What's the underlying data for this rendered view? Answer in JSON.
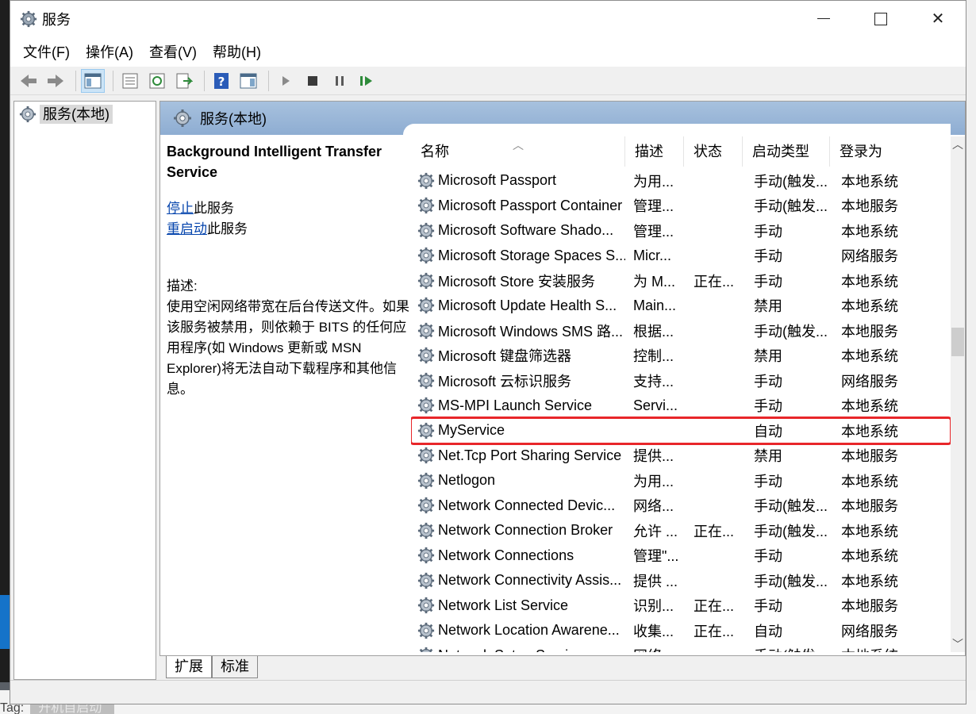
{
  "window": {
    "title": "服务",
    "controls": {
      "minimize": "minimize",
      "maximize": "maximize",
      "close": "✕"
    }
  },
  "menu": [
    "文件(F)",
    "操作(A)",
    "查看(V)",
    "帮助(H)"
  ],
  "tree": {
    "root_label": "服务(本地)"
  },
  "panel": {
    "header": "服务(本地)",
    "selected_title": "Background Intelligent Transfer Service",
    "action_stop_link": "停止",
    "action_stop_suffix": "此服务",
    "action_restart_link": "重启动",
    "action_restart_suffix": "此服务",
    "desc_label": "描述:",
    "desc_text": "使用空闲网络带宽在后台传送文件。如果该服务被禁用，则依赖于 BITS 的任何应用程序(如 Windows 更新或 MSN Explorer)将无法自动下载程序和其他信息。"
  },
  "columns": {
    "name": "名称",
    "desc": "描述",
    "status": "状态",
    "start": "启动类型",
    "logon": "登录为"
  },
  "services": [
    {
      "name": "Microsoft Passport",
      "desc": "为用...",
      "status": "",
      "start": "手动(触发...",
      "logon": "本地系统"
    },
    {
      "name": "Microsoft Passport Container",
      "desc": "管理...",
      "status": "",
      "start": "手动(触发...",
      "logon": "本地服务"
    },
    {
      "name": "Microsoft Software Shado...",
      "desc": "管理...",
      "status": "",
      "start": "手动",
      "logon": "本地系统"
    },
    {
      "name": "Microsoft Storage Spaces S...",
      "desc": "Micr...",
      "status": "",
      "start": "手动",
      "logon": "网络服务"
    },
    {
      "name": "Microsoft Store 安装服务",
      "desc": "为 M...",
      "status": "正在...",
      "start": "手动",
      "logon": "本地系统"
    },
    {
      "name": "Microsoft Update Health S...",
      "desc": "Main...",
      "status": "",
      "start": "禁用",
      "logon": "本地系统"
    },
    {
      "name": "Microsoft Windows SMS 路...",
      "desc": "根据...",
      "status": "",
      "start": "手动(触发...",
      "logon": "本地服务"
    },
    {
      "name": "Microsoft 键盘筛选器",
      "desc": "控制...",
      "status": "",
      "start": "禁用",
      "logon": "本地系统"
    },
    {
      "name": "Microsoft 云标识服务",
      "desc": "支持...",
      "status": "",
      "start": "手动",
      "logon": "网络服务"
    },
    {
      "name": "MS-MPI Launch Service",
      "desc": "Servi...",
      "status": "",
      "start": "手动",
      "logon": "本地系统"
    },
    {
      "name": "MyService",
      "desc": "",
      "status": "",
      "start": "自动",
      "logon": "本地系统"
    },
    {
      "name": "Net.Tcp Port Sharing Service",
      "desc": "提供...",
      "status": "",
      "start": "禁用",
      "logon": "本地服务"
    },
    {
      "name": "Netlogon",
      "desc": "为用...",
      "status": "",
      "start": "手动",
      "logon": "本地系统"
    },
    {
      "name": "Network Connected Devic...",
      "desc": "网络...",
      "status": "",
      "start": "手动(触发...",
      "logon": "本地服务"
    },
    {
      "name": "Network Connection Broker",
      "desc": "允许 ...",
      "status": "正在...",
      "start": "手动(触发...",
      "logon": "本地系统"
    },
    {
      "name": "Network Connections",
      "desc": "管理\"...",
      "status": "",
      "start": "手动",
      "logon": "本地系统"
    },
    {
      "name": "Network Connectivity Assis...",
      "desc": "提供 ...",
      "status": "",
      "start": "手动(触发...",
      "logon": "本地系统"
    },
    {
      "name": "Network List Service",
      "desc": "识别...",
      "status": "正在...",
      "start": "手动",
      "logon": "本地服务"
    },
    {
      "name": "Network Location Awarene...",
      "desc": "收集...",
      "status": "正在...",
      "start": "自动",
      "logon": "网络服务"
    },
    {
      "name": "Network Setup Service",
      "desc": "网络...",
      "status": "",
      "start": "手动(触发...",
      "logon": "本地系统"
    }
  ],
  "tabs": [
    "扩展",
    "标准"
  ],
  "background": {
    "tag_label": "Tag:",
    "tag_value": "开机自启动"
  },
  "colors": {
    "highlight": "#e8262a",
    "header_blue": "#9db9db",
    "link": "#0645ad"
  }
}
